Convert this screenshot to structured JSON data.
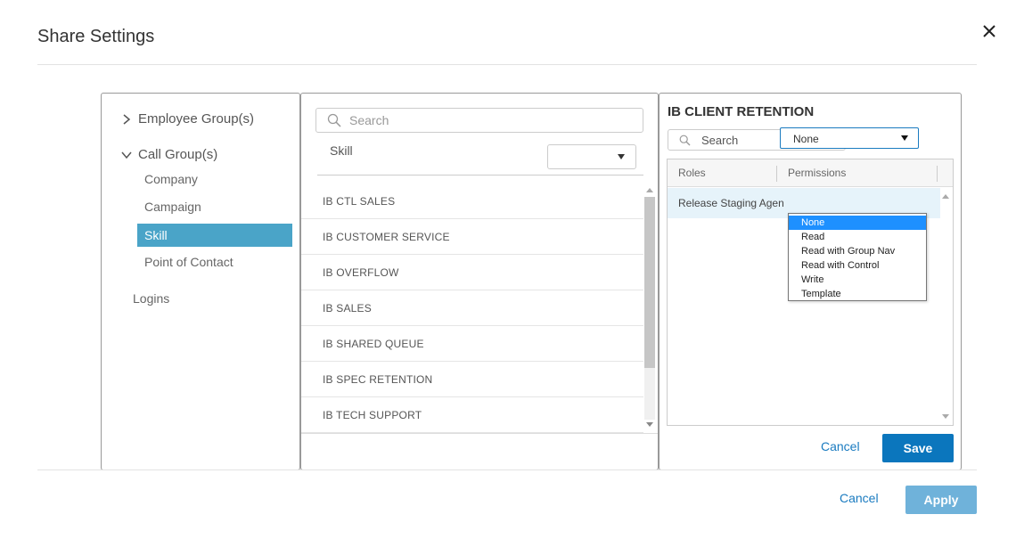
{
  "dialog": {
    "title": "Share Settings"
  },
  "tree": {
    "employee_group": "Employee Group(s)",
    "call_group": "Call Group(s)",
    "children": [
      {
        "label": "Company"
      },
      {
        "label": "Campaign"
      },
      {
        "label": "Skill"
      },
      {
        "label": "Point of Contact"
      }
    ],
    "selected": "Skill",
    "logins": "Logins"
  },
  "middle": {
    "search_placeholder": "Search",
    "label": "Skill",
    "filter_value": "",
    "items": [
      "IB CTL SALES",
      "IB CUSTOMER SERVICE",
      "IB OVERFLOW",
      "IB SALES",
      "IB SHARED QUEUE",
      "IB SPEC RETENTION",
      "IB TECH SUPPORT"
    ]
  },
  "right": {
    "title": "IB CLIENT RETENTION",
    "search_placeholder": "Search",
    "columns": {
      "roles": "Roles",
      "permissions": "Permissions"
    },
    "row": {
      "role": "Release Staging Agent",
      "permission": "None"
    },
    "dropdown_options": [
      "None",
      "Read",
      "Read with Group Nav",
      "Read with Control",
      "Write",
      "Template"
    ],
    "dropdown_active": "None",
    "cancel_label": "Cancel",
    "save_label": "Save"
  },
  "footer": {
    "cancel_label": "Cancel",
    "apply_label": "Apply"
  },
  "colors": {
    "selected_item": "#4aa4c8",
    "link": "#1a7bc0",
    "save": "#0b76bd",
    "apply": "#6fb2da",
    "dropdown_active": "#1e90ff"
  }
}
